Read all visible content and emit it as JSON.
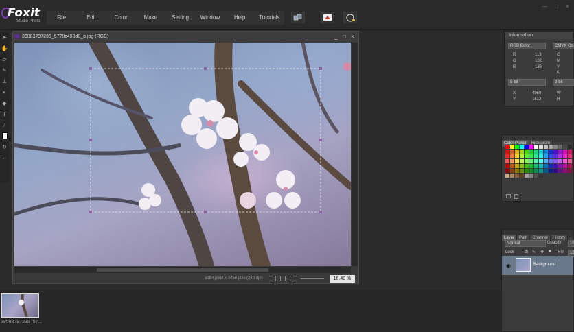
{
  "app": {
    "logo": "Foxit",
    "logo_sub": "Studio Photo"
  },
  "menu": [
    "File",
    "Edit",
    "Color",
    "Make",
    "Setting",
    "Window",
    "Help",
    "Tutorials"
  ],
  "toolbar_icons": [
    "cube-stack-icon",
    "layers-transform-icon",
    "grid-preview-icon"
  ],
  "window_controls": [
    "minimize-icon",
    "maximize-icon",
    "close-icon"
  ],
  "tools": [
    "arrow",
    "hand",
    "eraser",
    "brush",
    "stamp",
    "heal",
    "text",
    "eyedropper",
    "shape",
    "swap",
    "rotate"
  ],
  "document": {
    "title": "39083797235_5770c490d0_o.jpg (RGB)",
    "status": "5184 pixel x 3456 pixel(240 dpi)",
    "zoom": "16.49 %",
    "controls": [
      "_",
      "□",
      "×"
    ]
  },
  "filmstrip": {
    "item": "39083797235_57..."
  },
  "information": {
    "title": "Information",
    "mode1": "RGB Color",
    "mode2": "CMYK Co",
    "r_label": "R",
    "r": "113",
    "g_label": "G",
    "g": "102",
    "b_label": "B",
    "b": "136",
    "c_label": "C",
    "m_label": "M",
    "y_label": "Y",
    "k_label": "K",
    "bit1": "8-bit",
    "bit2": "8-bit",
    "x_label": "X",
    "x": "4959",
    "y2_label": "Y",
    "y": "1612",
    "w_label": "W",
    "h_label": "H"
  },
  "colorpicker": {
    "tabs": [
      "Color Picker",
      "Histogram"
    ]
  },
  "layers": {
    "tabs": [
      "Layer",
      "Path",
      "Channel",
      "History"
    ],
    "blend": "Normal",
    "opacity_label": "Opacity",
    "opacity": "10",
    "lock_label": "Lock",
    "fill_label": "Fill",
    "fill": "10",
    "layer_name": "Background"
  }
}
